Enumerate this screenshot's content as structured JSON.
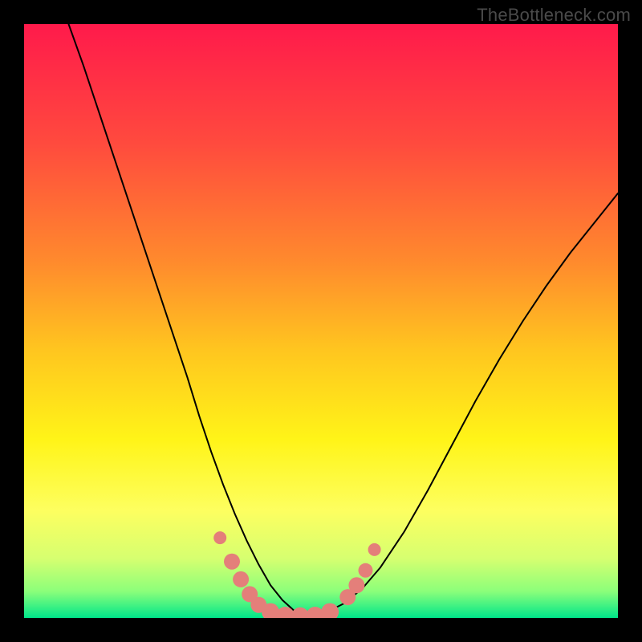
{
  "watermark": "TheBottleneck.com",
  "chart_data": {
    "type": "line",
    "title": "",
    "xlabel": "",
    "ylabel": "",
    "xlim": [
      0,
      1
    ],
    "ylim": [
      0,
      1
    ],
    "grid": false,
    "legend": false,
    "background": {
      "type": "vertical-gradient",
      "stops": [
        {
          "t": 0.0,
          "color": "#ff1a4b"
        },
        {
          "t": 0.2,
          "color": "#ff4a3e"
        },
        {
          "t": 0.4,
          "color": "#ff8a2d"
        },
        {
          "t": 0.55,
          "color": "#ffc61f"
        },
        {
          "t": 0.7,
          "color": "#fff418"
        },
        {
          "t": 0.82,
          "color": "#fdff60"
        },
        {
          "t": 0.9,
          "color": "#d6ff70"
        },
        {
          "t": 0.955,
          "color": "#8cff7a"
        },
        {
          "t": 1.0,
          "color": "#00e68a"
        }
      ]
    },
    "series": [
      {
        "name": "bottleneck-curve",
        "color": "#000000",
        "x": [
          0.075,
          0.1,
          0.125,
          0.15,
          0.175,
          0.2,
          0.225,
          0.25,
          0.275,
          0.295,
          0.315,
          0.335,
          0.355,
          0.375,
          0.395,
          0.415,
          0.435,
          0.455,
          0.48,
          0.51,
          0.54,
          0.57,
          0.6,
          0.64,
          0.68,
          0.72,
          0.76,
          0.8,
          0.84,
          0.88,
          0.92,
          0.96,
          1.0
        ],
        "y": [
          1.0,
          0.93,
          0.855,
          0.78,
          0.705,
          0.63,
          0.555,
          0.48,
          0.405,
          0.34,
          0.28,
          0.225,
          0.175,
          0.13,
          0.09,
          0.055,
          0.03,
          0.012,
          0.004,
          0.01,
          0.025,
          0.05,
          0.085,
          0.145,
          0.215,
          0.29,
          0.365,
          0.435,
          0.5,
          0.56,
          0.615,
          0.665,
          0.715
        ]
      }
    ],
    "markers": [
      {
        "name": "marker-dot",
        "x": 0.33,
        "y": 0.135,
        "r": 8,
        "color": "#e47f7a"
      },
      {
        "name": "marker-dot",
        "x": 0.35,
        "y": 0.095,
        "r": 10,
        "color": "#e47f7a"
      },
      {
        "name": "marker-dot",
        "x": 0.365,
        "y": 0.065,
        "r": 10,
        "color": "#e47f7a"
      },
      {
        "name": "marker-dot",
        "x": 0.38,
        "y": 0.04,
        "r": 10,
        "color": "#e47f7a"
      },
      {
        "name": "marker-dot",
        "x": 0.395,
        "y": 0.022,
        "r": 10,
        "color": "#e47f7a"
      },
      {
        "name": "marker-dot",
        "x": 0.415,
        "y": 0.01,
        "r": 11,
        "color": "#e47f7a"
      },
      {
        "name": "marker-dot",
        "x": 0.44,
        "y": 0.004,
        "r": 11,
        "color": "#e47f7a"
      },
      {
        "name": "marker-dot",
        "x": 0.465,
        "y": 0.003,
        "r": 11,
        "color": "#e47f7a"
      },
      {
        "name": "marker-dot",
        "x": 0.49,
        "y": 0.004,
        "r": 11,
        "color": "#e47f7a"
      },
      {
        "name": "marker-dot",
        "x": 0.515,
        "y": 0.01,
        "r": 11,
        "color": "#e47f7a"
      },
      {
        "name": "marker-dot",
        "x": 0.545,
        "y": 0.035,
        "r": 10,
        "color": "#e47f7a"
      },
      {
        "name": "marker-dot",
        "x": 0.56,
        "y": 0.055,
        "r": 10,
        "color": "#e47f7a"
      },
      {
        "name": "marker-dot",
        "x": 0.575,
        "y": 0.08,
        "r": 9,
        "color": "#e47f7a"
      },
      {
        "name": "marker-dot",
        "x": 0.59,
        "y": 0.115,
        "r": 8,
        "color": "#e47f7a"
      }
    ]
  }
}
